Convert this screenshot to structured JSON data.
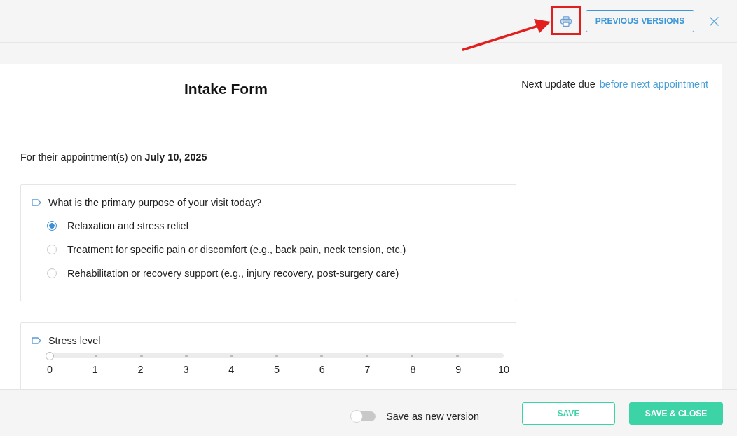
{
  "toolbar": {
    "previous_versions_button": "PREVIOUS VERSIONS"
  },
  "annotations": {
    "highlight_frame": true,
    "arrow": true
  },
  "form": {
    "title": "Intake Form",
    "next_update": {
      "label": "Next update due",
      "link": "before next appointment"
    },
    "appointment_note": "For their appointment(s) on **July 10, 2025**",
    "questions": [
      {
        "kind": "radio",
        "label": "What is the primary purpose of your visit today?",
        "options": [
          {
            "label": "Relaxation and stress relief",
            "selected": true
          },
          {
            "label": "Treatment for specific pain or discomfort (e.g., back pain, neck tension, etc.)",
            "selected": false
          },
          {
            "label": "Rehabilitation or recovery support (e.g., injury recovery, post-surgery care)",
            "selected": false
          }
        ]
      },
      {
        "kind": "slider",
        "label": "Stress level",
        "level": 0,
        "ticks": [
          "0",
          "1",
          "2",
          "3",
          "4",
          "5",
          "6",
          "7",
          "8",
          "9",
          "10"
        ]
      }
    ]
  },
  "footer": {
    "save_as_new_version": {
      "label": "Save as new version",
      "on": false
    },
    "buttons": [
      {
        "label": "SAVE",
        "kind": "outline"
      },
      {
        "label": "SAVE & CLOSE",
        "kind": "filled"
      }
    ]
  }
}
